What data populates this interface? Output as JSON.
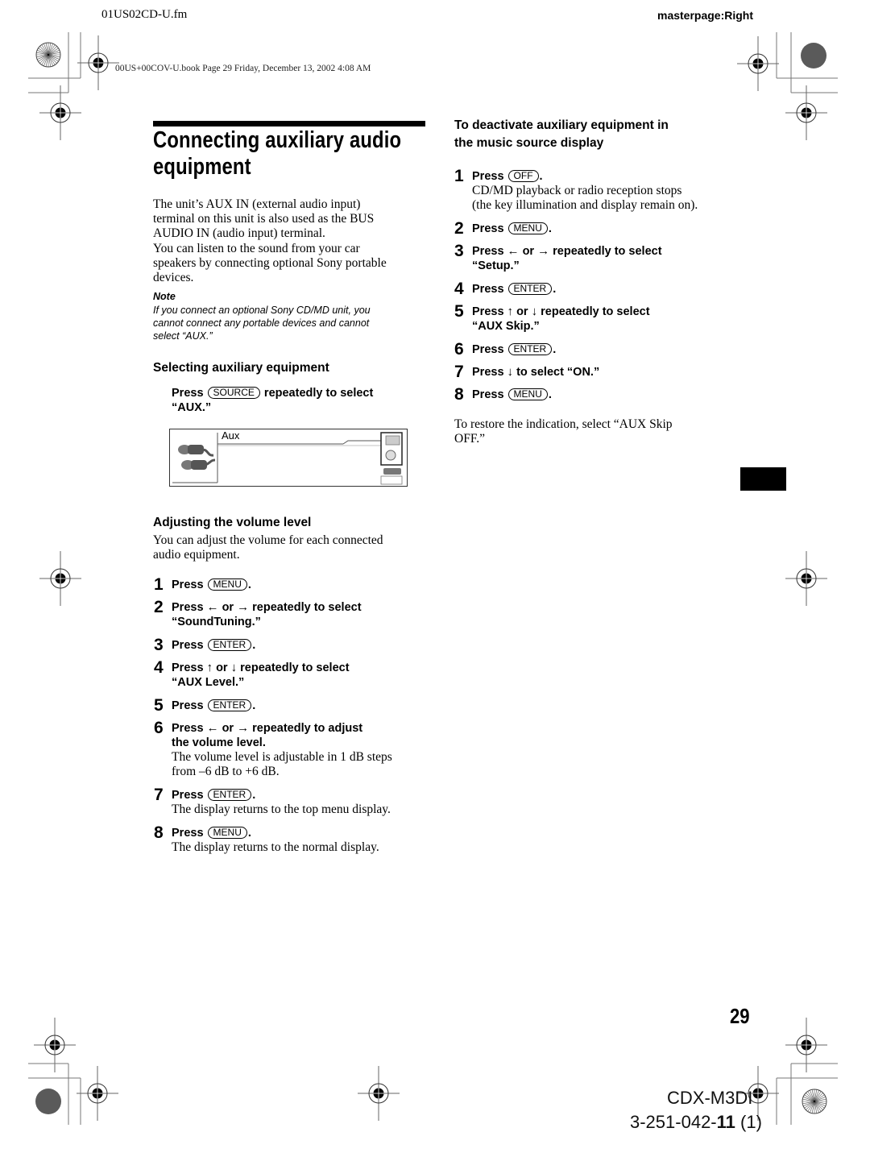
{
  "header": {
    "file_name": "01US02CD-U.fm",
    "masterpage": "masterpage:Right",
    "book_line": "00US+00COV-U.book  Page 29  Friday, December 13, 2002  4:08 AM"
  },
  "section": {
    "title_line1": "Connecting auxiliary audio",
    "title_line2": "equipment",
    "intro_lines": [
      "The unit’s AUX IN (external audio input)",
      "terminal on this unit is also used as the BUS",
      "AUDIO IN (audio input) terminal.",
      "You can listen to the sound from your car",
      "speakers by connecting optional Sony portable",
      "devices."
    ],
    "note_label": "Note",
    "note_lines": [
      "If you connect an optional Sony CD/MD unit, you",
      "cannot connect any portable devices and cannot",
      "select “AUX.”"
    ]
  },
  "selecting": {
    "heading": "Selecting auxiliary equipment",
    "press": "Press",
    "key": "SOURCE",
    "after_key": "repeatedly to select",
    "line2": "“AUX.”",
    "display_label": "Aux"
  },
  "volume": {
    "heading": "Adjusting the volume level",
    "intro_lines": [
      "You can adjust the volume for each connected",
      "audio equipment."
    ],
    "steps": [
      {
        "num": "1",
        "pre": "Press",
        "key": "MENU",
        "post": "."
      },
      {
        "num": "2",
        "pre": "Press",
        "arrow1": "←",
        "mid": "or",
        "arrow2": "→",
        "post": "repeatedly to select",
        "line2": "“SoundTuning.”"
      },
      {
        "num": "3",
        "pre": "Press",
        "key": "ENTER",
        "post": "."
      },
      {
        "num": "4",
        "pre": "Press",
        "arrow1": "↑",
        "mid": "or",
        "arrow2": "↓",
        "post": "repeatedly to select",
        "line2": "“AUX Level.”"
      },
      {
        "num": "5",
        "pre": "Press",
        "key": "ENTER",
        "post": "."
      },
      {
        "num": "6",
        "pre": "Press",
        "arrow1": "←",
        "mid": "or",
        "arrow2": "→",
        "post": "repeatedly to adjust",
        "line2": "the volume level.",
        "desc": [
          "The volume level is adjustable in 1 dB steps",
          "from –6 dB to +6 dB."
        ]
      },
      {
        "num": "7",
        "pre": "Press",
        "key": "ENTER",
        "post": ".",
        "desc": [
          "The display returns to the top menu display."
        ]
      },
      {
        "num": "8",
        "pre": "Press",
        "key": "MENU",
        "post": ".",
        "desc": [
          "The display returns to the normal display."
        ]
      }
    ]
  },
  "deactivate": {
    "heading_line1": "To deactivate auxiliary equipment in",
    "heading_line2": "the music source display",
    "steps": [
      {
        "num": "1",
        "pre": "Press",
        "key": "OFF",
        "post": ".",
        "desc": [
          "CD/MD playback or radio reception stops",
          "(the key illumination and display remain on)."
        ]
      },
      {
        "num": "2",
        "pre": "Press",
        "key": "MENU",
        "post": "."
      },
      {
        "num": "3",
        "pre": "Press",
        "arrow1": "←",
        "mid": "or",
        "arrow2": "→",
        "post": "repeatedly to select",
        "line2": "“Setup.”"
      },
      {
        "num": "4",
        "pre": "Press",
        "key": "ENTER",
        "post": "."
      },
      {
        "num": "5",
        "pre": "Press",
        "arrow1": "↑",
        "mid": "or",
        "arrow2": "↓",
        "post": "repeatedly to select",
        "line2": "“AUX Skip.”"
      },
      {
        "num": "6",
        "pre": "Press",
        "key": "ENTER",
        "post": "."
      },
      {
        "num": "7",
        "pre": "Press",
        "arrow1": "↓",
        "post": "to select “ON.”"
      },
      {
        "num": "8",
        "pre": "Press",
        "key": "MENU",
        "post": "."
      }
    ],
    "restore_lines": [
      "To restore the indication, select “AUX Skip",
      "OFF.”"
    ]
  },
  "footer": {
    "page_number": "29",
    "model": "CDX-M3DI",
    "part_prefix": "3-251-042-",
    "part_bold": "11",
    "part_suffix": " (1)"
  }
}
